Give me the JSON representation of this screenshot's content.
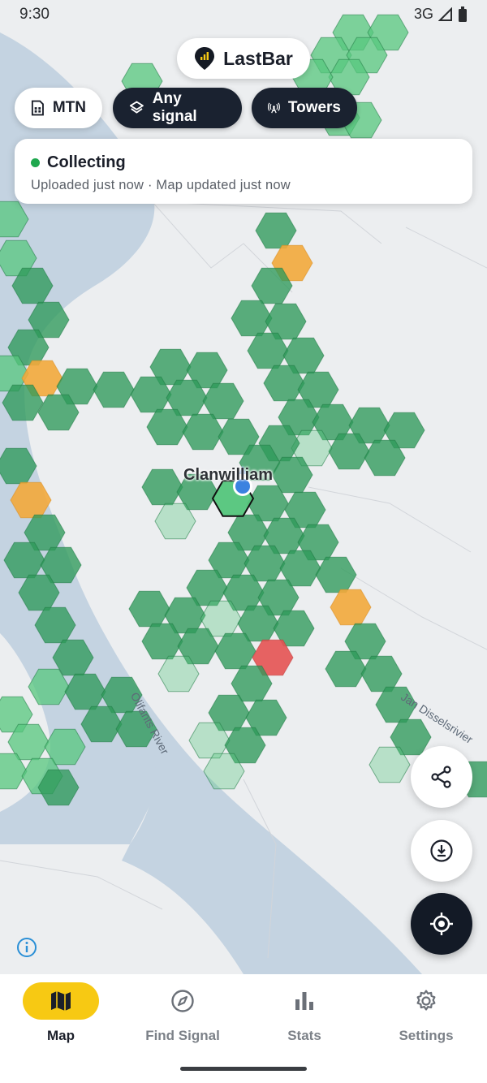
{
  "status_bar": {
    "time": "9:30",
    "network": "3G"
  },
  "app": {
    "title": "LastBar"
  },
  "chips": {
    "carrier": "MTN",
    "signal": "Any signal",
    "towers": "Towers"
  },
  "status_card": {
    "title": "Collecting",
    "subtitle": "Uploaded just now · Map updated just now"
  },
  "map": {
    "place_label": "Clanwilliam",
    "river_label": "Olifants River",
    "road_label": "Jan Disselsrivier",
    "colors": {
      "good": "#2e9a5a",
      "light": "#57c77e",
      "fair": "#f3a93b",
      "poor": "#e55252",
      "water": "#c4d3e1",
      "land": "#eceef0"
    }
  },
  "nav": {
    "items": [
      {
        "label": "Map",
        "icon": "map-icon",
        "active": true
      },
      {
        "label": "Find Signal",
        "icon": "compass-icon",
        "active": false
      },
      {
        "label": "Stats",
        "icon": "bar-chart-icon",
        "active": false
      },
      {
        "label": "Settings",
        "icon": "gear-icon",
        "active": false
      }
    ]
  }
}
